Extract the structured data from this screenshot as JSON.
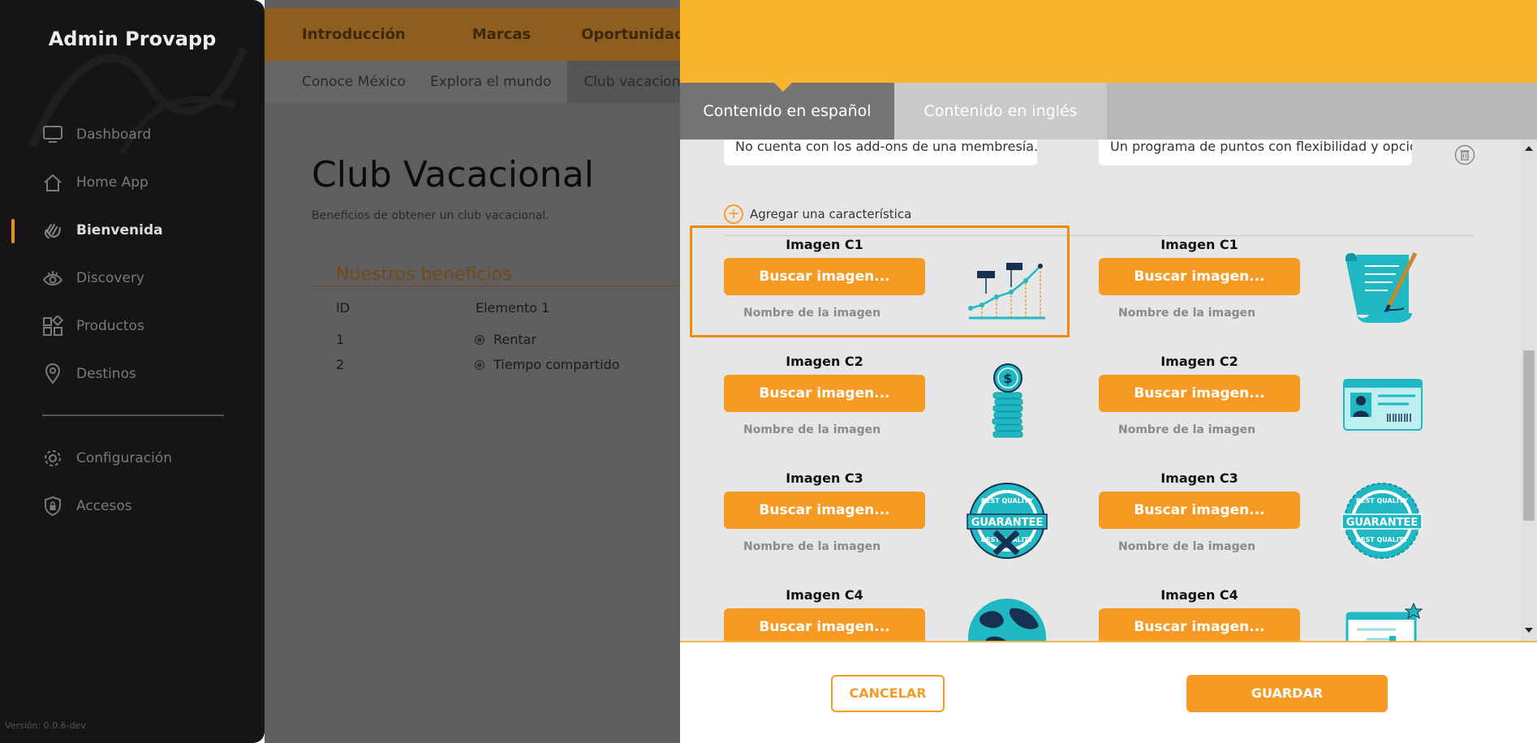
{
  "sidebar": {
    "brand": "Admin Provapp",
    "items": [
      {
        "label": "Dashboard",
        "icon": "monitor-icon"
      },
      {
        "label": "Home App",
        "icon": "home-icon"
      },
      {
        "label": "Bienvenida",
        "icon": "wave-hand-icon",
        "active": true
      },
      {
        "label": "Discovery",
        "icon": "eye-icon"
      },
      {
        "label": "Productos",
        "icon": "grid-icon"
      },
      {
        "label": "Destinos",
        "icon": "map-pin-icon"
      },
      {
        "label": "Configuración",
        "icon": "gear-icon"
      },
      {
        "label": "Accesos",
        "icon": "shield-lock-icon"
      }
    ],
    "version": "Versión: 0.0.6-dev"
  },
  "main": {
    "topnav": [
      "Introducción",
      "Marcas",
      "Oportunidades"
    ],
    "subnav": [
      "Conoce México",
      "Explora el mundo",
      "Club vacacional"
    ],
    "title": "Club Vacacional",
    "subtitle": "Beneficios de obtener un club vacacional.",
    "section_title": "Nuestros beneficios",
    "table": {
      "headers": [
        "ID",
        "Elemento 1"
      ],
      "rows": [
        {
          "id": "1",
          "value": "Rentar"
        },
        {
          "id": "2",
          "value": "Tiempo compartido"
        }
      ]
    }
  },
  "modal": {
    "tabs": [
      "Contenido en español",
      "Contenido en inglés"
    ],
    "fields": {
      "es_text": "No cuenta con los add-ons de una membresía.",
      "en_text": "Un programa de puntos con flexibilidad y opciones"
    },
    "add_feature": "Agregar una característica",
    "button_label": "Buscar imagen...",
    "name_placeholder": "Nombre de la imagen",
    "images_es": [
      {
        "label": "Imagen C1",
        "icon": "growth-chart-icon"
      },
      {
        "label": "Imagen C2",
        "icon": "coin-stack-icon"
      },
      {
        "label": "Imagen C3",
        "icon": "guarantee-seal-crossed-icon"
      },
      {
        "label": "Imagen C4",
        "icon": "globe-icon"
      }
    ],
    "images_en": [
      {
        "label": "Imagen C1",
        "icon": "scroll-contract-icon"
      },
      {
        "label": "Imagen C2",
        "icon": "id-card-icon"
      },
      {
        "label": "Imagen C3",
        "icon": "guarantee-seal-icon"
      },
      {
        "label": "Imagen C4",
        "icon": "browser-window-icon"
      }
    ],
    "seal_text": {
      "top": "BEST QUALITY",
      "middle": "GUARANTEE",
      "bottom": "BEST QUALITY"
    },
    "coin_symbol": "$",
    "cancel": "CANCELAR",
    "save": "GUARDAR"
  },
  "colors": {
    "accent": "#f79a24",
    "header": "#f9b52b",
    "teal": "#1fb8c3",
    "navy": "#16304f"
  }
}
